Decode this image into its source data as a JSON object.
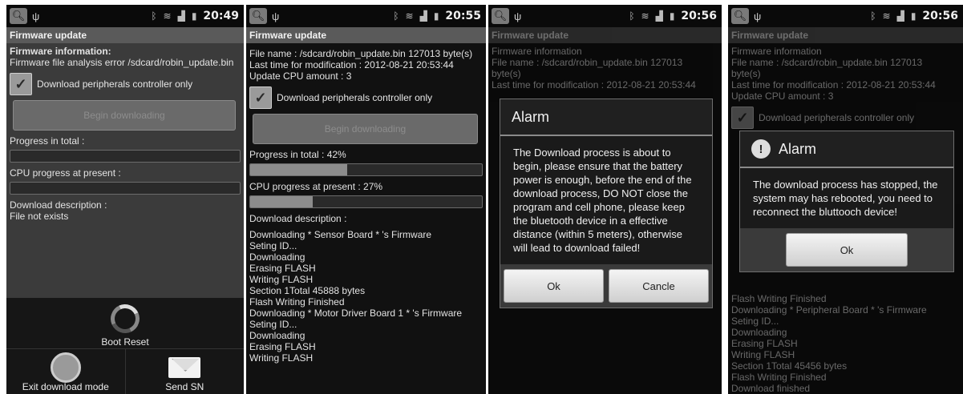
{
  "screens": [
    {
      "time": "20:49",
      "title": "Firmware update",
      "firmware_info_label": "Firmware information:",
      "firmware_info_text": "Firmware file analysis error /sdcard/robin_update.bin",
      "checkbox_label": "Download peripherals controller only",
      "begin_button": "Begin downloading",
      "progress_total_label": "Progress in total :",
      "progress_total": 0,
      "cpu_progress_label": "CPU progress at present :",
      "cpu_progress": 0,
      "download_desc_label": "Download description :",
      "download_desc_text": "File not exists",
      "boot_reset_label": "Boot Reset",
      "exit_label": "Exit download mode",
      "send_label": "Send SN"
    },
    {
      "time": "20:55",
      "title": "Firmware update",
      "file_name": "File name : /sdcard/robin_update.bin  127013 byte(s)",
      "last_mod": "Last time for modification : 2012-08-21 20:53:44",
      "update_cpu": "Update CPU amount : 3",
      "checkbox_label": "Download peripherals controller only",
      "begin_button": "Begin downloading",
      "progress_total_label": "Progress in total : 42%",
      "progress_total": 0.42,
      "cpu_progress_label": "CPU progress at present : 27%",
      "cpu_progress": 0.27,
      "download_desc_label": "Download description :",
      "log": [
        "Downloading * Sensor Board * 's Firmware",
        "Seting ID...",
        "Downloading",
        "Erasing FLASH",
        "Writing FLASH",
        "Section 1Total 45888 bytes",
        "Flash Writing Finished",
        "Downloading * Motor Driver Board 1 * 's Firmware",
        "Seting ID...",
        "Downloading",
        "Erasing FLASH",
        "Writing FLASH"
      ]
    },
    {
      "time": "20:56",
      "title": "Firmware update",
      "bg_lines": [
        "Firmware information",
        "File name : /sdcard/robin_update.bin  127013",
        "byte(s)",
        "Last time for modification : 2012-08-21 20:53:44"
      ],
      "dialog_title": "Alarm",
      "dialog_text": "The Download process is about to begin, please ensure that the battery power is enough, before the end of the download process, DO NOT close the program and cell phone, please keep the bluetooth device in a effective distance (within 5 meters), otherwise will lead to download failed!",
      "ok_label": "Ok",
      "cancel_label": "Cancle"
    },
    {
      "time": "20:56",
      "title": "Firmware update",
      "bg_lines": [
        "Firmware information",
        "File name : /sdcard/robin_update.bin  127013",
        "byte(s)",
        "Last time for modification : 2012-08-21 20:53:44",
        "Update CPU amount : 3"
      ],
      "bg_checkbox_label": "Download peripherals controller only",
      "bg_log": [
        "Flash Writing Finished",
        "Downloading * Peripheral Board * 's Firmware",
        "Seting ID...",
        "Downloading",
        "Erasing FLASH",
        "Writing FLASH",
        "Section 1Total 45456 bytes",
        "Flash Writing Finished",
        "Download finished"
      ],
      "dialog_title": "Alarm",
      "dialog_text": "The download process has stopped, the system may has rebooted, you need to reconnect the bluttooch device!",
      "ok_label": "Ok"
    }
  ],
  "icons": {
    "search": "search-icon",
    "usb": "usb-icon",
    "bluetooth": "bluetooth-icon",
    "wifi": "wifi-icon",
    "signal": "signal-icon",
    "battery": "battery-icon"
  }
}
